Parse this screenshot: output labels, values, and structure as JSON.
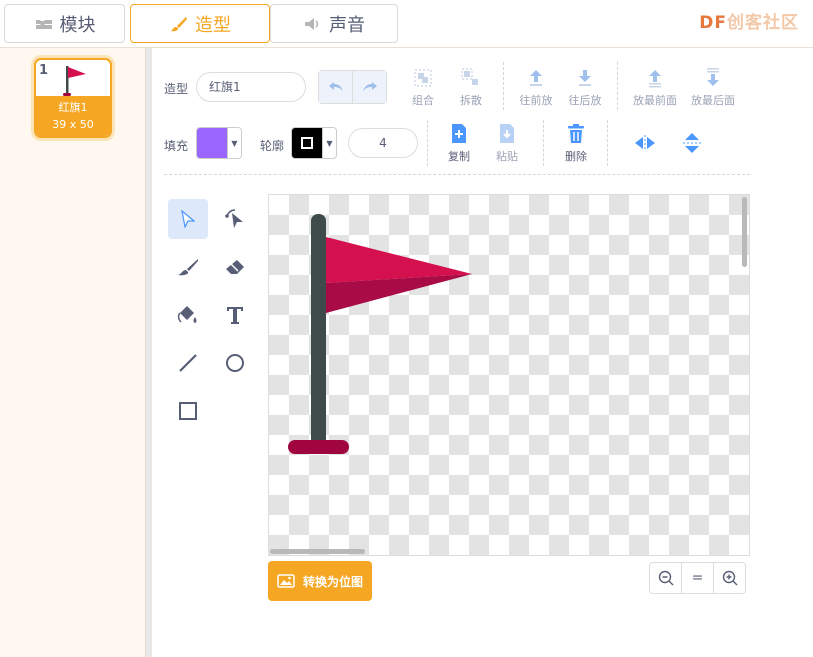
{
  "tabs": [
    {
      "label": "模块",
      "icon": "blocks-icon",
      "active": false
    },
    {
      "label": "造型",
      "icon": "brush-icon",
      "active": true
    },
    {
      "label": "声音",
      "icon": "speaker-icon",
      "active": false
    }
  ],
  "watermark": {
    "prefix": "DF",
    "text": "创客社区"
  },
  "costume": {
    "number": "1",
    "name": "红旗1",
    "size": "39 x 50"
  },
  "toolbar": {
    "costume_label": "造型",
    "costume_name": "红旗1",
    "group": "组合",
    "ungroup": "拆散",
    "forward": "往前放",
    "backward": "往后放",
    "front": "放最前面",
    "back": "放最后面",
    "fill_label": "填充",
    "fill_color": "#9966ff",
    "outline_label": "轮廓",
    "outline_color": "#000000",
    "outline_width": "4",
    "copy": "复制",
    "paste": "粘贴",
    "delete": "删除"
  },
  "tools": [
    "select-tool",
    "reshape-tool",
    "brush-tool",
    "eraser-tool",
    "fill-tool",
    "text-tool",
    "line-tool",
    "circle-tool",
    "rectangle-tool"
  ],
  "bottom": {
    "convert": "转换为位图",
    "zoom_reset": "="
  },
  "colors": {
    "accent": "#f5a623",
    "flag_red": "#d5104f",
    "flag_dark": "#a80b45",
    "pole": "#3e4b4a",
    "base": "#a0053f"
  }
}
